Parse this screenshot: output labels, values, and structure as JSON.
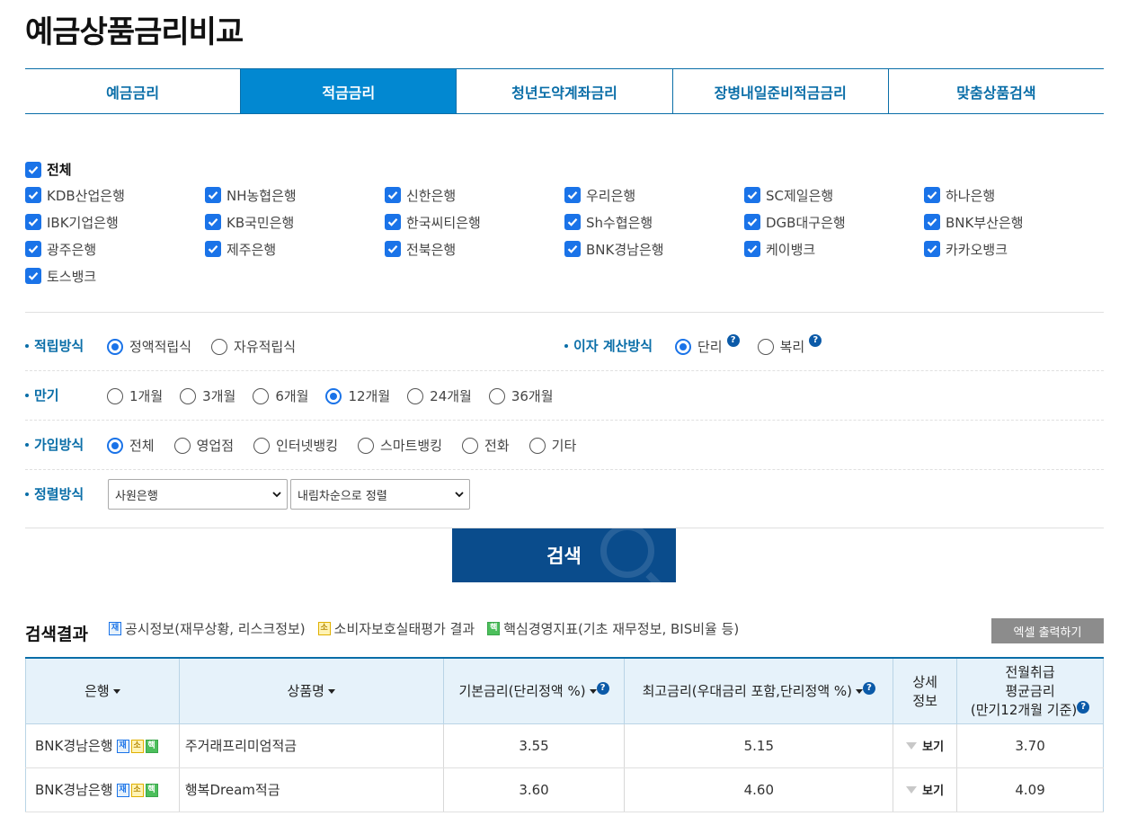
{
  "page_title": "예금상품금리비교",
  "tabs": [
    "예금금리",
    "적금금리",
    "청년도약계좌금리",
    "장병내일준비적금금리",
    "맞춤상품검색"
  ],
  "active_tab": 1,
  "banks": {
    "all_label": "전체",
    "items": [
      "KDB산업은행",
      "NH농협은행",
      "신한은행",
      "우리은행",
      "SC제일은행",
      "하나은행",
      "IBK기업은행",
      "KB국민은행",
      "한국씨티은행",
      "Sh수협은행",
      "DGB대구은행",
      "BNK부산은행",
      "광주은행",
      "제주은행",
      "전북은행",
      "BNK경남은행",
      "케이뱅크",
      "카카오뱅크",
      "토스뱅크"
    ]
  },
  "options": {
    "saving_method": {
      "label": "적립방식",
      "choices": [
        "정액적립식",
        "자유적립식"
      ],
      "selected": 0
    },
    "interest_method": {
      "label": "이자 계산방식",
      "choices": [
        "단리",
        "복리"
      ],
      "selected": 0
    },
    "term": {
      "label": "만기",
      "choices": [
        "1개월",
        "3개월",
        "6개월",
        "12개월",
        "24개월",
        "36개월"
      ],
      "selected": 3
    },
    "join_method": {
      "label": "가입방식",
      "choices": [
        "전체",
        "영업점",
        "인터넷뱅킹",
        "스마트뱅킹",
        "전화",
        "기타"
      ],
      "selected": 0
    },
    "sort": {
      "label": "정렬방식",
      "field": "사원은행",
      "order": "내림차순으로 정렬"
    }
  },
  "search_button": "검색",
  "results": {
    "title": "검색결과",
    "legend": [
      {
        "badge": "재",
        "text": "공시정보(재무상황, 리스크정보)"
      },
      {
        "badge": "소",
        "text": "소비자보호실태평가 결과"
      },
      {
        "badge": "핵",
        "text": "핵심경영지표(기초 재무정보, BIS비율 등)"
      }
    ],
    "excel_button": "엑셀 출력하기",
    "columns": {
      "bank": "은행",
      "product": "상품명",
      "base_rate": "기본금리(단리정액 %)",
      "max_rate": "최고금리(우대금리 포함,단리정액 %)",
      "detail_1": "상세",
      "detail_2": "정보",
      "avg_1": "전월취급",
      "avg_2": "평균금리",
      "avg_3": "(만기12개월 기준)"
    },
    "view_label": "보기",
    "rows": [
      {
        "bank": "BNK경남은행",
        "product": "주거래프리미엄적금",
        "base_rate": "3.55",
        "max_rate": "5.15",
        "avg_rate": "3.70"
      },
      {
        "bank": "BNK경남은행",
        "product": "행복Dream적금",
        "base_rate": "3.60",
        "max_rate": "4.60",
        "avg_rate": "4.09"
      }
    ]
  },
  "icons": {
    "help": "?",
    "badge_jae": "재",
    "badge_so": "소",
    "badge_haek": "핵"
  }
}
